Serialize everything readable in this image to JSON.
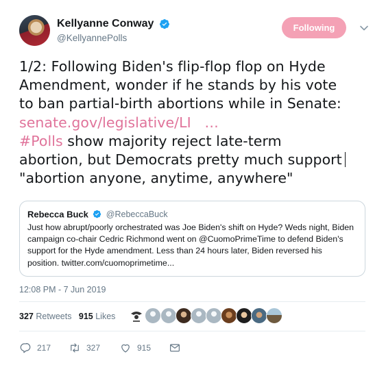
{
  "author": {
    "display_name": "Kellyanne Conway",
    "handle": "@KellyannePolls",
    "verified": true,
    "follow_button_label": "Following"
  },
  "tweet": {
    "lines": [
      "1/2: Following Biden's flip-flop flop on Hyde",
      "Amendment, wonder if he stands by his vote",
      "to ban partial-birth abortions while in Senate:"
    ],
    "link_text": "senate.gov/legislative/LI",
    "link_ellipsis": "…",
    "hashtag": "#Polls",
    "after_hashtag": " show majority reject late-term",
    "line5": "abortion, but Democrats pretty much support",
    "line6": "\"abortion anyone, anytime, anywhere\""
  },
  "quoted": {
    "name": "Rebecca Buck",
    "handle": "@RebeccaBuck",
    "lines": [
      "Just how abrupt/poorly orchestrated was Joe Biden's shift on Hyde? Weds night, Biden",
      "campaign co-chair Cedric Richmond went on @CuomoPrimeTime to defend Biden's",
      "support for the Hyde amendment. Less than 24 hours later, Biden reversed his",
      "position. twitter.com/cuomoprimetime..."
    ]
  },
  "timestamp": "12:08 PM - 7 Jun 2019",
  "stats": {
    "retweets_count": "327",
    "retweets_label": "Retweets",
    "likes_count": "915",
    "likes_label": "Likes"
  },
  "actions": {
    "replies": "217",
    "retweets": "327",
    "likes": "915"
  },
  "colors": {
    "accent_pink": "#e0739a",
    "follow_button": "#f4a1b5",
    "verified_blue": "#1da1f2",
    "secondary_text": "#657786"
  },
  "icons": [
    "verified-badge-icon",
    "chevron-down-icon",
    "reply-icon",
    "retweet-icon",
    "like-icon",
    "message-icon"
  ]
}
